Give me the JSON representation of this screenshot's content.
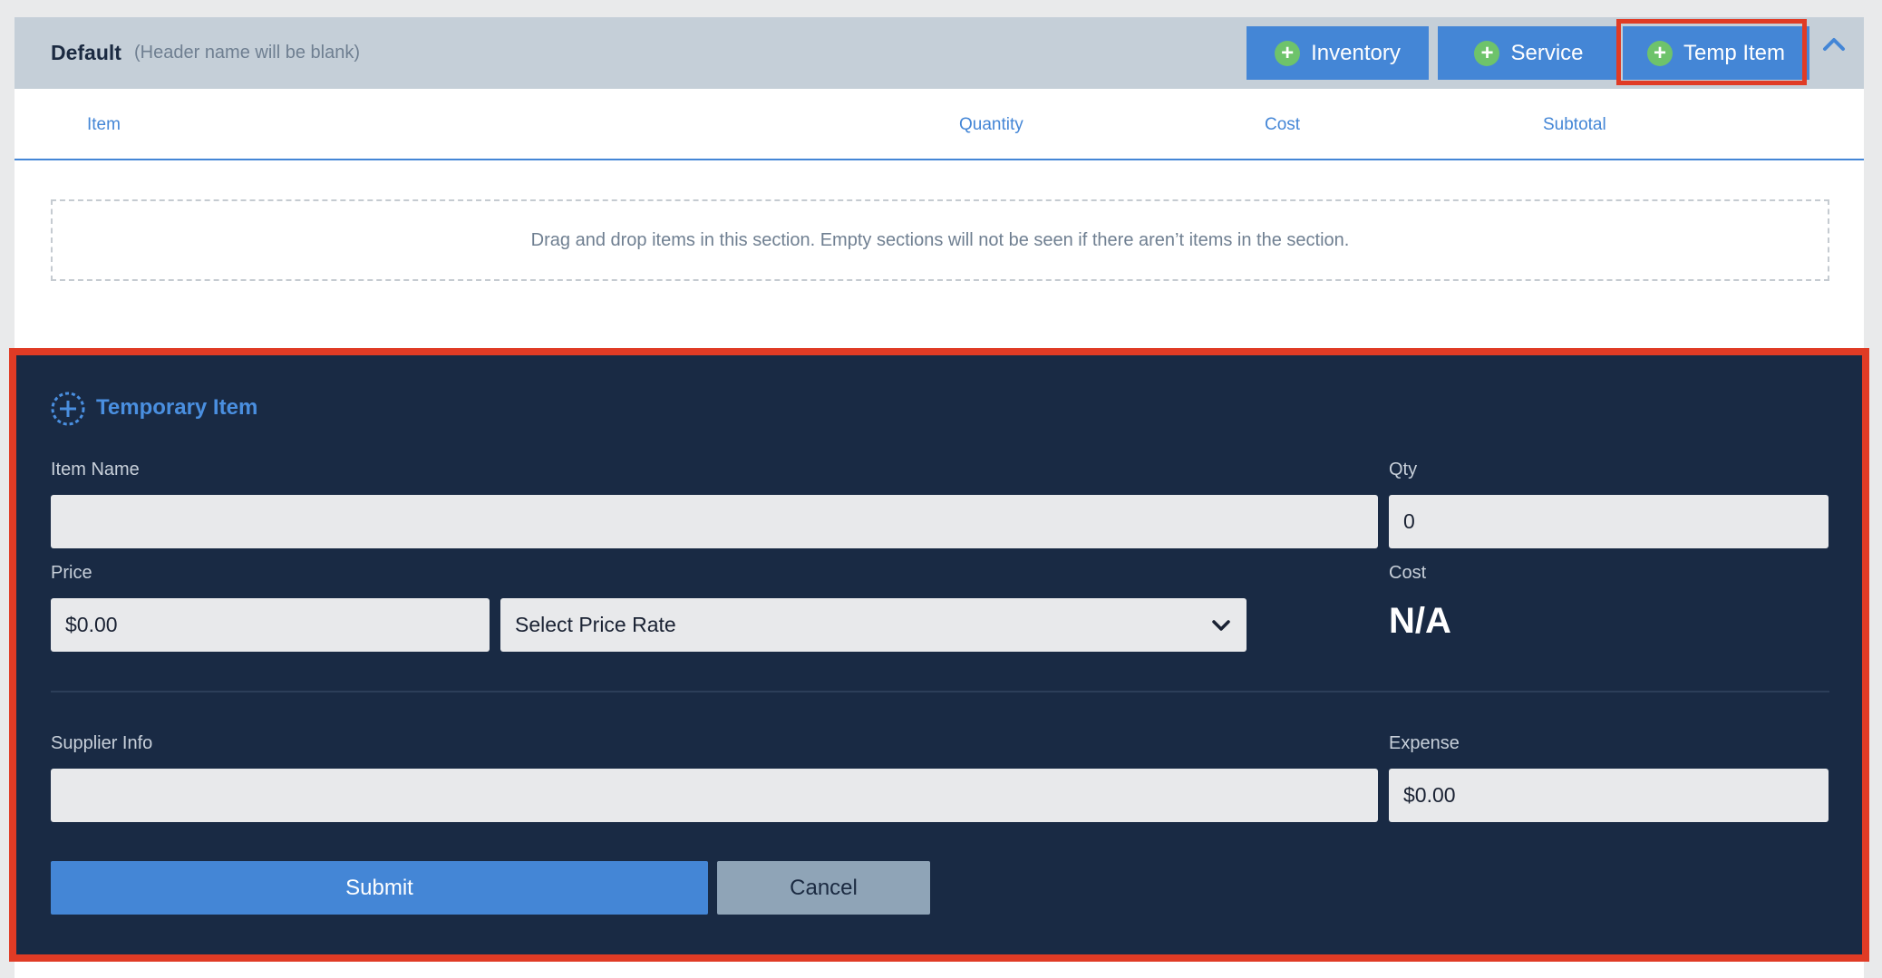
{
  "section": {
    "title": "Default",
    "subtitle": "(Header name will be blank)",
    "buttons": {
      "inventory": "Inventory",
      "service": "Service",
      "temp_item": "Temp Item"
    }
  },
  "columns": {
    "item": "Item",
    "quantity": "Quantity",
    "cost": "Cost",
    "subtotal": "Subtotal"
  },
  "drop_zone_text": "Drag and drop items in this section. Empty sections will not be seen if there aren’t items in the section.",
  "temp_form": {
    "title": "Temporary Item",
    "item_name_label": "Item Name",
    "item_name_value": "",
    "qty_label": "Qty",
    "qty_value": "0",
    "price_label": "Price",
    "price_value": "$0.00",
    "price_rate_selected": "Select Price Rate",
    "cost_label": "Cost",
    "cost_value": "N/A",
    "supplier_label": "Supplier Info",
    "supplier_value": "",
    "expense_label": "Expense",
    "expense_value": "$0.00",
    "submit_label": "Submit",
    "cancel_label": "Cancel"
  },
  "colors": {
    "accent": "#4486d6",
    "highlight": "#e03b25",
    "form_bg": "#192a44",
    "plus_green": "#6ec36b"
  }
}
